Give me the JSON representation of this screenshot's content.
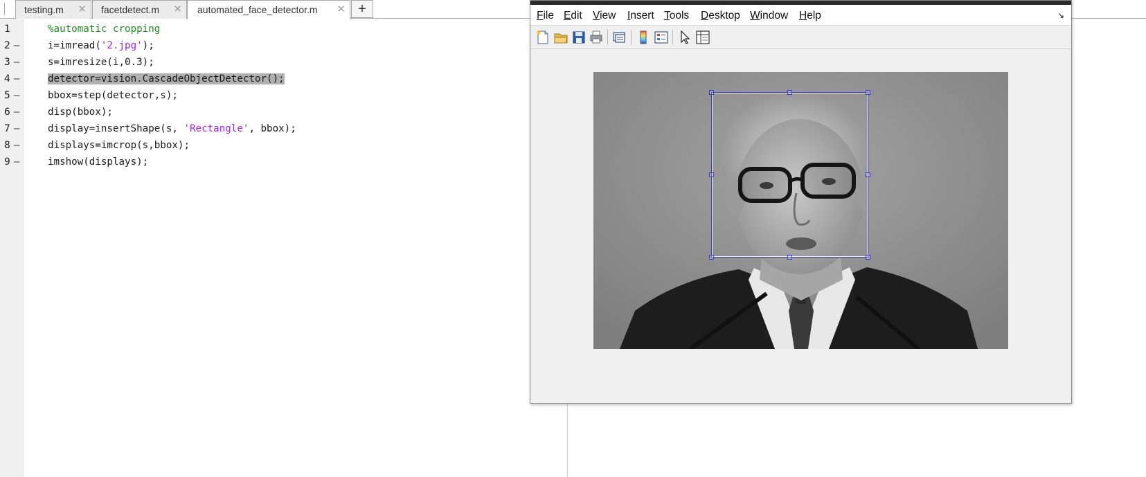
{
  "tabs": [
    {
      "label": "testing.m",
      "close": "✕",
      "active": false
    },
    {
      "label": "facetdetect.m",
      "close": "✕",
      "active": false
    },
    {
      "label": "automated_face_detector.m",
      "close": "✕",
      "active": true
    }
  ],
  "tab_add_label": "+",
  "code_lines": [
    {
      "num": "1",
      "dash": "",
      "segments": [
        {
          "t": "%automatic cropping",
          "c": "cmt"
        }
      ]
    },
    {
      "num": "2",
      "dash": "–",
      "segments": [
        {
          "t": "i=imread(",
          "c": ""
        },
        {
          "t": "'2.jpg'",
          "c": "str"
        },
        {
          "t": ");",
          "c": ""
        }
      ]
    },
    {
      "num": "3",
      "dash": "–",
      "segments": [
        {
          "t": "s=imresize(i,0.3);",
          "c": ""
        }
      ]
    },
    {
      "num": "4",
      "dash": "–",
      "segments": [
        {
          "t": "detector=vision.CascadeObjectDetector();",
          "c": "hl"
        }
      ]
    },
    {
      "num": "5",
      "dash": "–",
      "segments": [
        {
          "t": "bbox=step(detector,s);",
          "c": ""
        }
      ]
    },
    {
      "num": "6",
      "dash": "–",
      "segments": [
        {
          "t": "disp(bbox);",
          "c": ""
        }
      ]
    },
    {
      "num": "7",
      "dash": "–",
      "segments": [
        {
          "t": "display=insertShape(s, ",
          "c": ""
        },
        {
          "t": "'Rectangle'",
          "c": "str"
        },
        {
          "t": ", bbox);",
          "c": ""
        }
      ]
    },
    {
      "num": "8",
      "dash": "–",
      "segments": [
        {
          "t": "displays=imcrop(s,bbox);",
          "c": ""
        }
      ]
    },
    {
      "num": "9",
      "dash": "–",
      "segments": [
        {
          "t": "imshow(displays);",
          "c": ""
        }
      ]
    }
  ],
  "figure": {
    "menu": [
      {
        "label": "File",
        "mnemonic": "F"
      },
      {
        "label": "Edit",
        "mnemonic": "E"
      },
      {
        "label": "View",
        "mnemonic": "V"
      },
      {
        "label": "Insert",
        "mnemonic": "I"
      },
      {
        "label": "Tools",
        "mnemonic": "T"
      },
      {
        "label": "Desktop",
        "mnemonic": "D"
      },
      {
        "label": "Window",
        "mnemonic": "W"
      },
      {
        "label": "Help",
        "mnemonic": "H"
      }
    ],
    "dock_glyph": "↘",
    "toolbar": [
      "new-figure-icon",
      "open-file-icon",
      "save-icon",
      "print-icon",
      "print-preview-icon",
      "colorbar-icon",
      "legend-icon",
      "pointer-icon",
      "property-editor-icon"
    ],
    "image_description": "grayscale photo, face selected with bounding rectangle"
  },
  "colors": {
    "comment": "#228b22",
    "string": "#a020f0",
    "highlight": "#b0b0b0",
    "bbox": "#3a3ad8"
  }
}
